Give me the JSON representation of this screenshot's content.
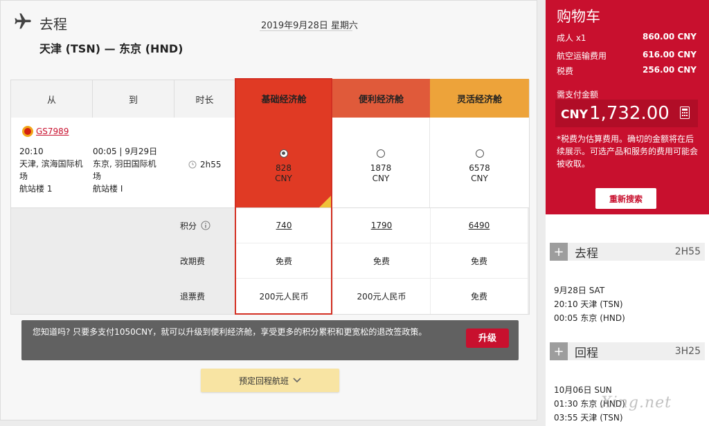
{
  "segment": {
    "title": "去程",
    "date": "2019年9月28日 星期六",
    "route": "天津 (TSN) — 东京 (HND)"
  },
  "table": {
    "headers": {
      "from": "从",
      "to": "到",
      "duration": "时长"
    },
    "fares": [
      {
        "name": "基础经济舱",
        "price": "828",
        "currency": "CNY",
        "points": "740",
        "change_fee": "免费",
        "refund_fee": "200元人民币",
        "color": "#e03a24",
        "selected": true
      },
      {
        "name": "便利经济舱",
        "price": "1878",
        "currency": "CNY",
        "points": "1790",
        "change_fee": "免费",
        "refund_fee": "200元人民币",
        "color": "#e05a3a",
        "selected": false
      },
      {
        "name": "灵活经济舱",
        "price": "6578",
        "currency": "CNY",
        "points": "6490",
        "change_fee": "免费",
        "refund_fee": "免费",
        "color": "#eda33a",
        "selected": false
      }
    ],
    "flight": {
      "number": "GS7989",
      "dep_time": "20:10",
      "dep_place_1": "天津, 滨海国际机",
      "dep_place_2": "场",
      "dep_terminal": "航站楼 1",
      "arr_time": "00:05 | 9月29日",
      "arr_place_1": "东京, 羽田国际机",
      "arr_place_2": "场",
      "arr_terminal": "航站楼 I",
      "duration": "2h55"
    },
    "row_labels": {
      "points": "积分",
      "change_fee": "改期费",
      "refund_fee": "退票费"
    }
  },
  "upgrade": {
    "message": "您知道吗? 只要多支付1050CNY，就可以升级到便利经济舱，享受更多的积分累积和更宽松的退改签政策。",
    "button": "升级"
  },
  "return_button": "预定回程航班",
  "cart": {
    "title": "购物车",
    "lines": [
      {
        "label": "成人 x1",
        "value": "860.00 CNY"
      },
      {
        "label": "航空运输费用",
        "value": "616.00 CNY"
      },
      {
        "label": "税费",
        "value": "256.00 CNY"
      }
    ],
    "due_label": "需支付金额",
    "total_currency": "CNY",
    "total_amount": "1,732.00",
    "note": "*税费为估算费用。确切的金额将在后续展示。可选产品和服务的费用可能会被收取。",
    "research_button": "重新搜索"
  },
  "summary": {
    "outbound": {
      "title": "去程",
      "duration": "2H55",
      "date": "9月28日 SAT",
      "line1": "20:10 天津 (TSN)",
      "line2": "00:05 东京 (HND)"
    },
    "inbound": {
      "title": "回程",
      "duration": "3H25",
      "date": "10月06日 SUN",
      "line1": "01:30 东京 (HND)",
      "line2": "03:55 天津 (TSN)"
    }
  },
  "watermark": "Xing.net",
  "colors": {
    "brand_red": "#c8102e",
    "selected_fare": "#e03a24",
    "upgrade_bar": "#616161"
  }
}
